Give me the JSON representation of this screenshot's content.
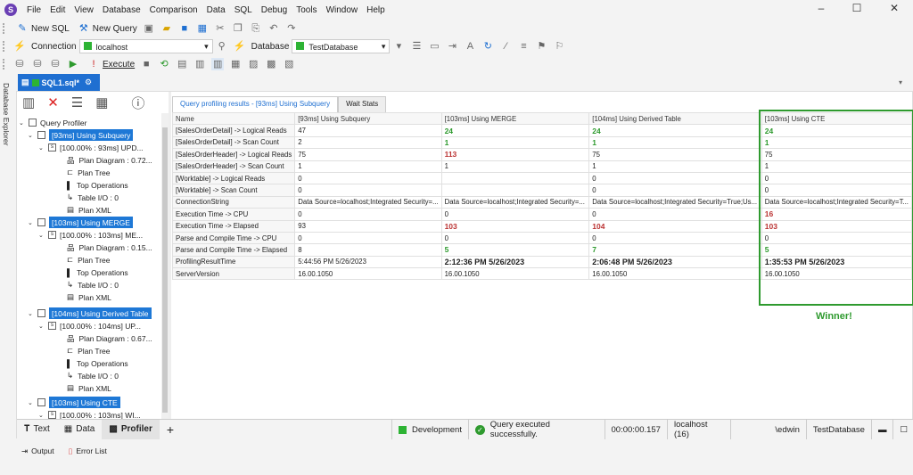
{
  "menu": [
    "File",
    "Edit",
    "View",
    "Database",
    "Comparison",
    "Data",
    "SQL",
    "Debug",
    "Tools",
    "Window",
    "Help"
  ],
  "toolbar1": {
    "new_sql": "New SQL",
    "new_query": "New Query"
  },
  "toolbar2": {
    "connection_label": "Connection",
    "connection_value": "localhost",
    "database_label": "Database",
    "database_value": "TestDatabase"
  },
  "toolbar3": {
    "execute": "Execute"
  },
  "doc_tab": "SQL1.sql*",
  "side_strip": "Database Explorer",
  "tree": {
    "root": "Query Profiler",
    "groups": [
      {
        "label": "[93ms] Using Subquery",
        "sub": "[100.00% : 93ms] UPD...",
        "plan": "Plan Diagram : 0.72..."
      },
      {
        "label": "[103ms] Using MERGE",
        "sub": "[100.00% : 103ms] ME...",
        "plan": "Plan Diagram : 0.15..."
      },
      {
        "label": "[104ms] Using Derived Table",
        "sub": "[100.00% : 104ms] UP...",
        "plan": "Plan Diagram : 0.67..."
      },
      {
        "label": "[103ms] Using CTE",
        "sub": "[100.00% : 103ms] WI..."
      }
    ],
    "items": [
      "Plan Tree",
      "Top Operations",
      "Table I/O : 0",
      "Plan XML"
    ]
  },
  "result_tabs": [
    "Query profiling results - [93ms] Using Subquery",
    "Wait Stats"
  ],
  "grid": {
    "headers": [
      "Name",
      "[93ms] Using Subquery",
      "[103ms] Using MERGE",
      "[104ms] Using Derived Table",
      "[103ms] Using CTE"
    ],
    "rows": [
      [
        "[SalesOrderDetail] -> Logical Reads",
        "47",
        "24",
        "24",
        "24"
      ],
      [
        "[SalesOrderDetail] -> Scan Count",
        "2",
        "1",
        "1",
        "1"
      ],
      [
        "[SalesOrderHeader] -> Logical Reads",
        "75",
        "113",
        "75",
        "75"
      ],
      [
        "[SalesOrderHeader] -> Scan Count",
        "1",
        "1",
        "1",
        "1"
      ],
      [
        "[Worktable] -> Logical Reads",
        "0",
        "",
        "0",
        "0"
      ],
      [
        "[Worktable] -> Scan Count",
        "0",
        "",
        "0",
        "0"
      ],
      [
        "ConnectionString",
        "Data Source=localhost;Integrated Security=...",
        "Data Source=localhost;Integrated Security=...",
        "Data Source=localhost;Integrated Security=True;Us...",
        "Data Source=localhost;Integrated Security=T..."
      ],
      [
        "Execution Time -> CPU",
        "0",
        "0",
        "0",
        "16"
      ],
      [
        "Execution Time -> Elapsed",
        "93",
        "103",
        "104",
        "103"
      ],
      [
        "Parse and Compile Time -> CPU",
        "0",
        "0",
        "0",
        "0"
      ],
      [
        "Parse and Compile Time -> Elapsed",
        "8",
        "5",
        "7",
        "5"
      ],
      [
        "ProfilingResultTime",
        "5:44:56 PM 5/26/2023",
        "2:12:36 PM 5/26/2023",
        "2:06:48 PM 5/26/2023",
        "1:35:53 PM 5/26/2023"
      ],
      [
        "ServerVersion",
        "16.00.1050",
        "16.00.1050",
        "16.00.1050",
        "16.00.1050"
      ]
    ]
  },
  "winner_label": "Winner!",
  "bottom_tabs": [
    "Text",
    "Data",
    "Profiler"
  ],
  "status": {
    "env": "Development",
    "msg": "Query executed successfully.",
    "time": "00:00:00.157",
    "server": "localhost (16)",
    "user": "\\edwin",
    "db": "TestDatabase"
  },
  "footer": [
    "Output",
    "Error List"
  ]
}
